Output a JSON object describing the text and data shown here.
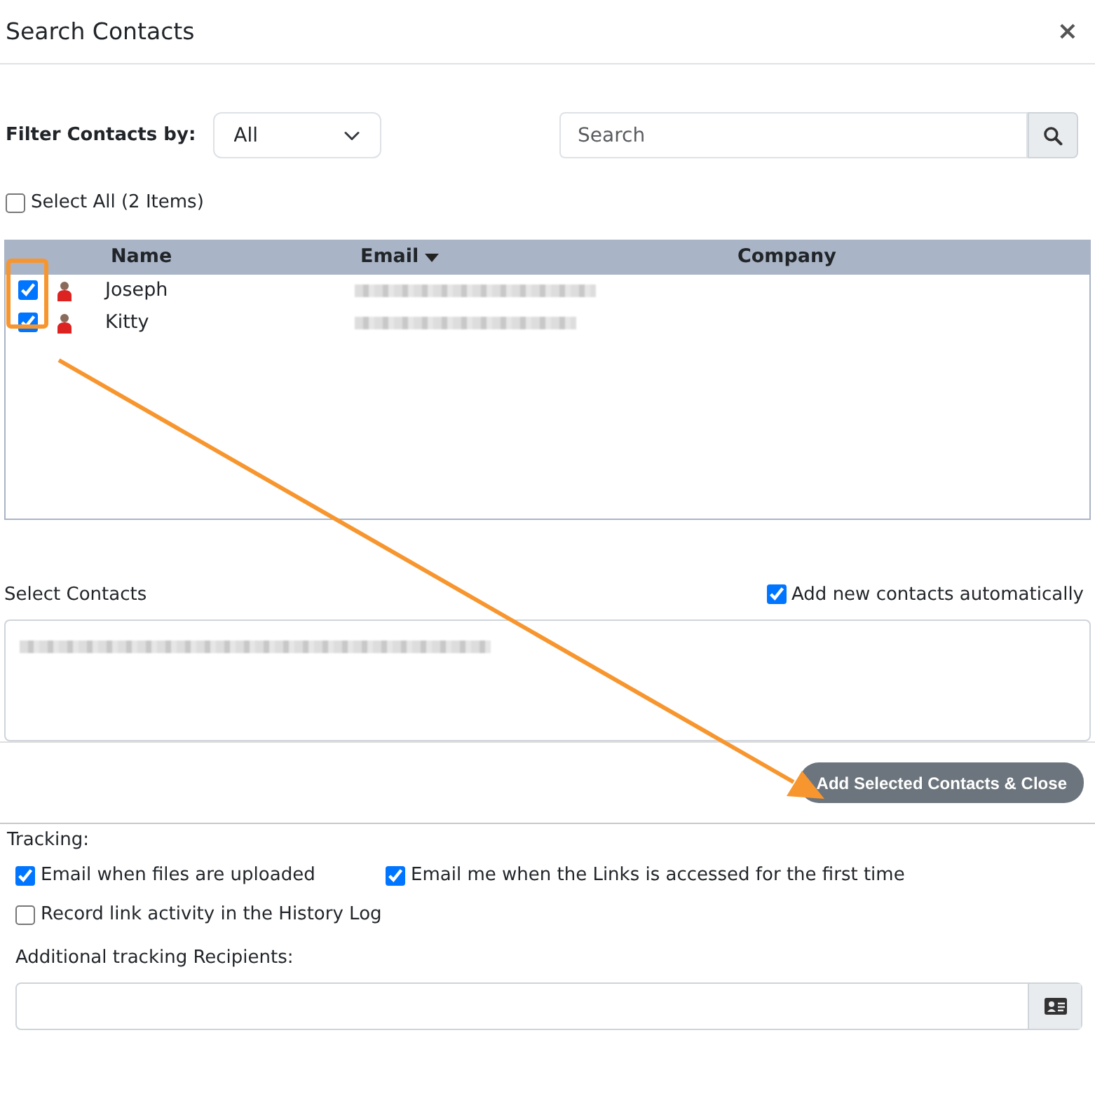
{
  "window": {
    "title": "Search Contacts",
    "close": "×"
  },
  "filter": {
    "label": "Filter Contacts by:",
    "value": "All"
  },
  "search": {
    "placeholder": "Search"
  },
  "select_all": {
    "label": "Select All (2 Items)",
    "checked": false
  },
  "table": {
    "columns": [
      {
        "label": "Name",
        "sorted": false
      },
      {
        "label": "Email",
        "sorted": true
      },
      {
        "label": "Company",
        "sorted": false
      }
    ],
    "rows": [
      {
        "checked": true,
        "name": "Joseph",
        "email_redacted": true
      },
      {
        "checked": true,
        "name": "Kitty",
        "email_redacted": true
      }
    ]
  },
  "select_contacts": {
    "label": "Select Contacts",
    "value_redacted": true
  },
  "auto_add": {
    "label": "Add new contacts automatically",
    "checked": true
  },
  "add_button": "Add Selected Contacts & Close",
  "tracking": {
    "label": "Tracking:",
    "options": [
      {
        "label": "Email when files are uploaded",
        "checked": true
      },
      {
        "label": "Email me when the Links is accessed for the first time",
        "checked": true
      },
      {
        "label": "Record link activity in the History Log",
        "checked": false
      }
    ],
    "recipients_label": "Additional tracking Recipients:"
  },
  "annotation": {
    "highlight": true,
    "arrow": true
  }
}
